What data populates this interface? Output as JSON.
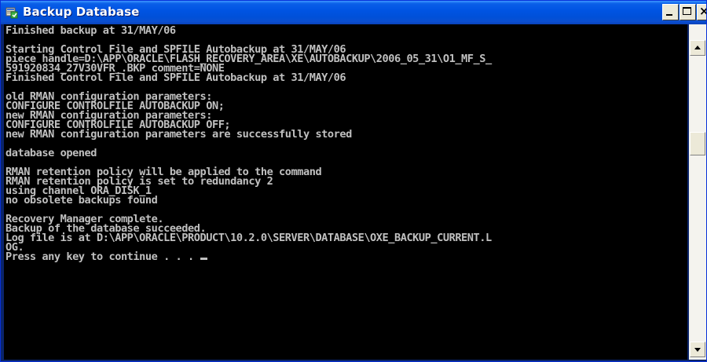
{
  "window": {
    "title": "Backup Database",
    "minimize_label": "_",
    "maximize_label": "□",
    "close_label": "×"
  },
  "console": {
    "lines": [
      "Finished backup at 31/MAY/06",
      "",
      "Starting Control File and SPFILE Autobackup at 31/MAY/06",
      "piece handle=D:\\APP\\ORACLE\\FLASH_RECOVERY_AREA\\XE\\AUTOBACKUP\\2006_05_31\\O1_MF_S_",
      "591920834_27V30VFR_.BKP comment=NONE",
      "Finished Control File and SPFILE Autobackup at 31/MAY/06",
      "",
      "old RMAN configuration parameters:",
      "CONFIGURE CONTROLFILE AUTOBACKUP ON;",
      "new RMAN configuration parameters:",
      "CONFIGURE CONTROLFILE AUTOBACKUP OFF;",
      "new RMAN configuration parameters are successfully stored",
      "",
      "database opened",
      "",
      "RMAN retention policy will be applied to the command",
      "RMAN retention policy is set to redundancy 2",
      "using channel ORA_DISK_1",
      "no obsolete backups found",
      "",
      "Recovery Manager complete.",
      "Backup of the database succeeded.",
      "Log file is at D:\\APP\\ORACLE\\PRODUCT\\10.2.0\\SERVER\\DATABASE\\OXE_BACKUP_CURRENT.L",
      "OG.",
      "Press any key to continue . . . "
    ]
  },
  "icons": {
    "app": "database-backup-icon",
    "minimize": "minimize-icon",
    "maximize": "maximize-icon",
    "close": "close-icon",
    "scroll_up": "arrow-up-icon",
    "scroll_down": "arrow-down-icon"
  },
  "colors": {
    "titlebar": "#0054e3",
    "console_bg": "#000000",
    "console_fg": "#c0c0c0"
  }
}
